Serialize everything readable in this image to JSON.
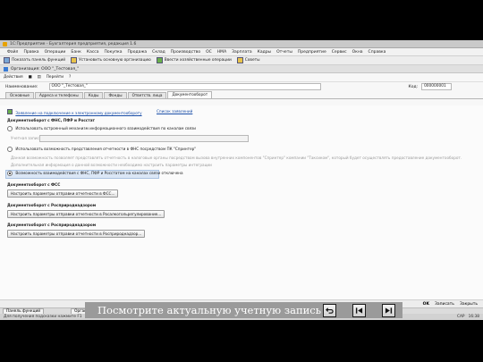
{
  "app": {
    "title": "1С:Предприятие - Бухгалтерия предприятия, редакция 1.6",
    "menu": [
      "Файл",
      "Правка",
      "Операции",
      "Банк",
      "Касса",
      "Покупка",
      "Продажа",
      "Склад",
      "Производство",
      "ОС",
      "НМА",
      "Зарплата",
      "Кадры",
      "Отчеты",
      "Предприятие",
      "Сервис",
      "Окна",
      "Справка"
    ],
    "toolbar": {
      "panel": "Показать панель функций",
      "main_org": "Установить основную организацию",
      "journal": "Ввести хозяйственные операции",
      "tips": "Советы"
    }
  },
  "window": {
    "title": "Организация: ООО \"_Тестовая_\"",
    "actions": "Действия",
    "goto": "Перейти",
    "name_label": "Наименование:",
    "name_value": "ООО \"_Тестовая_\"",
    "code_label": "Код:",
    "code_value": "000000001",
    "tabs": [
      "Основные",
      "Адреса и телефоны",
      "Коды",
      "Фонды",
      "Ответств. лица",
      "Документооборот"
    ]
  },
  "content": {
    "link_statement": "Заявление на подключение к электронному документообороту",
    "link_list": "Список заявлений",
    "section_fns": "Документооборот с ФНС, ПФР и Росстат",
    "opt_builtin": "Использовать встроенный механизм информационного взаимодействия по каналам связи",
    "account_label": "Учетная запись:",
    "opt_strizh": "Использовать возможность представления отчетности в ФНС посредством ПК \"Спринтер\"",
    "strizh_desc": "Данная возможность позволяет представлять отчетность в налоговые органы посредством вызова внутренних компонентов \"Спринтер\" компании \"Таксиком\", который будет осуществлять предоставление документооборот.",
    "strizh_link": "Дополнительная информация о данной возможности необходимо настроить параметры интеграции",
    "opt_interaction": "Возможность взаимодействия с ФНС, ПФР и Росстатом на каналах связи отключена",
    "section_fss": "Документооборот с ФСС",
    "btn_fss": "Настроить параметры отправки отчетности в ФСС...",
    "section_rpn": "Документооборот с Росприроднадзором",
    "btn_rpn": "Настроить параметры отправки отчетности в Росалкогольрегулирование...",
    "section_rpn2": "Документооборот с Росприроднадзором",
    "btn_rpn2": "Настроить параметры отправки отчетности в Росприроднадзор..."
  },
  "bottom": {
    "ok": "OK",
    "write": "Записать",
    "close": "Закрыть"
  },
  "taskbar": {
    "panel": "Панель функций",
    "org": "Организации"
  },
  "status": {
    "hint": "Для получения подсказки нажмите F1",
    "cap": "CAP",
    "time": "16:38"
  },
  "overlay": {
    "caption": "Посмотрите актуальную учетную запись",
    "icons": [
      "return-icon",
      "prev-icon",
      "next-icon"
    ]
  }
}
